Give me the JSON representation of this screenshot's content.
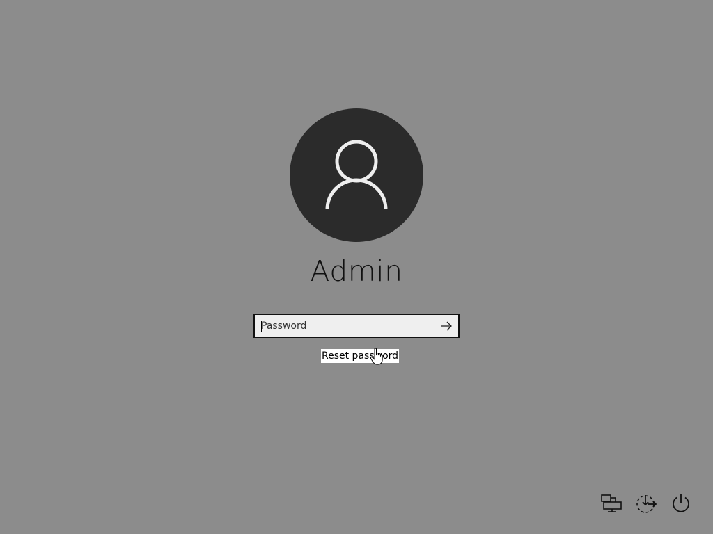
{
  "user": {
    "name": "Admin",
    "avatar_icon": "user-silhouette-icon"
  },
  "password_field": {
    "placeholder": "Password",
    "value": ""
  },
  "submit": {
    "icon": "arrow-right-icon"
  },
  "reset_link": {
    "label": "Reset password"
  },
  "corner_buttons": [
    {
      "name": "network",
      "icon": "network-icon"
    },
    {
      "name": "ease-of-access",
      "icon": "ease-of-access-icon"
    },
    {
      "name": "power",
      "icon": "power-icon"
    }
  ],
  "colors": {
    "background": "#8c8c8c",
    "avatar_bg": "#2b2b2b",
    "avatar_fg": "#eeeeee",
    "input_bg": "#efefef",
    "text": "#111111"
  }
}
